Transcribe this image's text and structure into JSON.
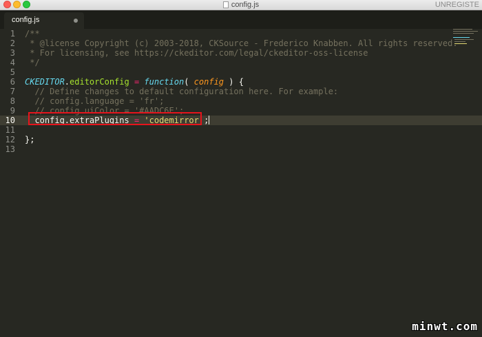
{
  "window": {
    "title": "config.js",
    "registration": "UNREGISTE"
  },
  "tab": {
    "label": "config.js"
  },
  "editor": {
    "line_numbers": [
      "1",
      "2",
      "3",
      "4",
      "5",
      "6",
      "7",
      "8",
      "9",
      "10",
      "11",
      "12",
      "13"
    ],
    "active_line": 10,
    "lines": {
      "l1": "/**",
      "l2": " * @license Copyright (c) 2003-2018, CKSource - Frederico Knabben. All rights reserved.",
      "l3": " * For licensing, see https://ckeditor.com/legal/ckeditor-oss-license",
      "l4": " */",
      "l6": {
        "obj": "CKEDITOR",
        "dot": ".",
        "prop": "editorConfig",
        "eq": " = ",
        "fn": "function",
        "open": "( ",
        "param": "config",
        "close": " ) {"
      },
      "l7": "  // Define changes to default configuration here. For example:",
      "l8": "  // config.language = 'fr';",
      "l9": "  // config.uiColor = '#AADC6E';",
      "l10": {
        "lhs": "  config.extraPlugins",
        "eq": " = ",
        "str": "'codemirror'",
        "end": ";"
      },
      "l12": "};"
    }
  },
  "colors": {
    "background": "#272822",
    "comment": "#75715e",
    "keyword": "#66d9ef",
    "function_name": "#a6e22e",
    "operator": "#f92672",
    "parameter": "#fd971f",
    "string": "#e6db74",
    "highlight_box": "#e8141c"
  },
  "watermark": "minwt.com"
}
